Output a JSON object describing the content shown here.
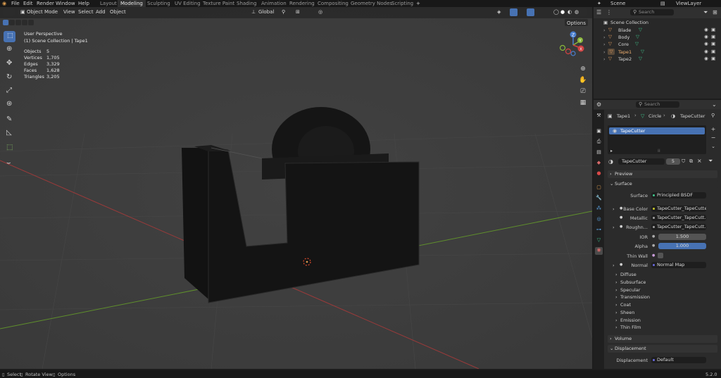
{
  "menu": [
    "File",
    "Edit",
    "Render",
    "Window",
    "Help"
  ],
  "workspaces": [
    {
      "label": "Layout",
      "active": false
    },
    {
      "label": "Modeling",
      "active": true
    },
    {
      "label": "Sculpting",
      "active": false
    },
    {
      "label": "UV Editing",
      "active": false
    },
    {
      "label": "Texture Paint",
      "active": false
    },
    {
      "label": "Shading",
      "active": false
    },
    {
      "label": "Animation",
      "active": false
    },
    {
      "label": "Rendering",
      "active": false
    },
    {
      "label": "Compositing",
      "active": false
    },
    {
      "label": "Geometry Nodes",
      "active": false
    },
    {
      "label": "Scripting",
      "active": false
    }
  ],
  "add_workspace": "+",
  "scene": {
    "label": "Scene",
    "viewlayer": "ViewLayer"
  },
  "viewport_header": {
    "mode": "Object Mode",
    "menus": [
      "View",
      "Select",
      "Add",
      "Object"
    ],
    "orientation": "Global",
    "options": "Options"
  },
  "viewport_overlay": {
    "view": "User Perspective",
    "collection": "(1) Scene Collection | Tape1",
    "stats": [
      {
        "k": "Objects",
        "v": "5"
      },
      {
        "k": "Vertices",
        "v": "1,705"
      },
      {
        "k": "Edges",
        "v": "3,329"
      },
      {
        "k": "Faces",
        "v": "1,628"
      },
      {
        "k": "Triangles",
        "v": "3,205"
      }
    ]
  },
  "gizmo": {
    "z": "Z",
    "y": "Y",
    "x": "X"
  },
  "outliner": {
    "search_placeholder": "Search",
    "root": "Scene Collection",
    "items": [
      "Blade",
      "Body",
      "Core",
      "Tape1",
      "Tape2"
    ]
  },
  "properties": {
    "search_placeholder": "Search",
    "breadcrumb": [
      "Tape1",
      "Circle",
      "TapeCutter"
    ],
    "material_slot": "TapeCutter",
    "material_name": "TapeCutter",
    "user_count": "5",
    "panels": {
      "preview": "Preview",
      "surface": "Surface",
      "volume": "Volume",
      "displacement": "Displacement"
    },
    "surface": {
      "label": "Surface",
      "value": "Principled BSDF"
    },
    "rows": [
      {
        "label": "Base Color",
        "value": "TapeCutter_TapeCutte"
      },
      {
        "label": "Metallic",
        "value": "TapeCutter_TapeCutt..."
      },
      {
        "label": "Roughn...",
        "value": "TapeCutter_TapeCutt..."
      }
    ],
    "ior": {
      "label": "IOR",
      "value": "1.500"
    },
    "alpha": {
      "label": "Alpha",
      "value": "1.000"
    },
    "thin_wall": {
      "label": "Thin Wall"
    },
    "normal": {
      "label": "Normal",
      "value": "Normal Map"
    },
    "subpanels": [
      "Diffuse",
      "Subsurface",
      "Specular",
      "Transmission",
      "Coat",
      "Sheen",
      "Emission",
      "Thin Film"
    ],
    "displacement": {
      "label": "Displacement",
      "value": "Default"
    }
  },
  "statusbar": {
    "select": "Select",
    "rotate": "Rotate View",
    "options": "Options",
    "version": "5.2.0"
  }
}
